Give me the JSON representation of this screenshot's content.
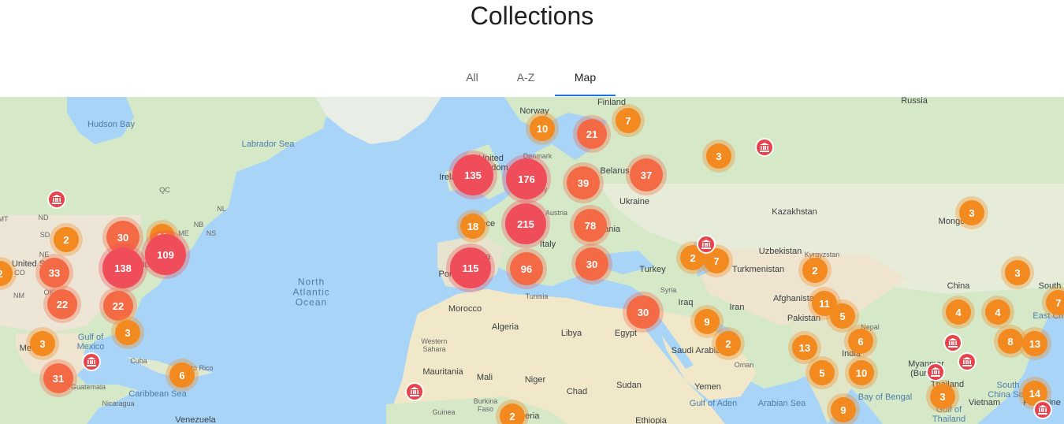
{
  "page": {
    "title": "Collections"
  },
  "tabs": [
    {
      "label": "All",
      "active": false
    },
    {
      "label": "A-Z",
      "active": false
    },
    {
      "label": "Map",
      "active": true
    }
  ],
  "colors": {
    "accent": "#1a73e8",
    "cluster_small": "#f38a1f",
    "cluster_medium": "#f36a44",
    "cluster_large": "#ef4d5a",
    "museum": "#e8434d",
    "water": "#a8d4f7"
  },
  "map": {
    "labels": [
      {
        "text": "Hudson Bay",
        "type": "water"
      },
      {
        "text": "Labrador Sea",
        "type": "water"
      },
      {
        "text": "North\nAtlantic\nOcean",
        "type": "ocean"
      },
      {
        "text": "Gulf of\nMexico",
        "type": "water"
      },
      {
        "text": "Caribbean Sea",
        "type": "water"
      },
      {
        "text": "Finland",
        "type": "land"
      },
      {
        "text": "Norway",
        "type": "land"
      },
      {
        "text": "Russia",
        "type": "land"
      },
      {
        "text": "Denmark",
        "type": "small"
      },
      {
        "text": "United\nKingdom",
        "type": "land"
      },
      {
        "text": "Ireland",
        "type": "land"
      },
      {
        "text": "Germany",
        "type": "small"
      },
      {
        "text": "Belarus",
        "type": "land"
      },
      {
        "text": "Ukraine",
        "type": "land"
      },
      {
        "text": "Kazakhstan",
        "type": "land"
      },
      {
        "text": "Mongolia",
        "type": "land"
      },
      {
        "text": "Austria",
        "type": "small"
      },
      {
        "text": "France",
        "type": "land"
      },
      {
        "text": "Romania",
        "type": "land"
      },
      {
        "text": "Italy",
        "type": "land"
      },
      {
        "text": "Spain",
        "type": "land"
      },
      {
        "text": "Portugal",
        "type": "land"
      },
      {
        "text": "Greece",
        "type": "small"
      },
      {
        "text": "Turkey",
        "type": "land"
      },
      {
        "text": "Uzbekistan",
        "type": "land"
      },
      {
        "text": "Kyrgyzstan",
        "type": "small"
      },
      {
        "text": "Turkmenistan",
        "type": "land"
      },
      {
        "text": "China",
        "type": "land"
      },
      {
        "text": "South",
        "type": "land"
      },
      {
        "text": "Tunisia",
        "type": "small"
      },
      {
        "text": "Syria",
        "type": "small"
      },
      {
        "text": "Iraq",
        "type": "land"
      },
      {
        "text": "Iran",
        "type": "land"
      },
      {
        "text": "Afghanistan",
        "type": "land"
      },
      {
        "text": "Pakistan",
        "type": "land"
      },
      {
        "text": "Nepal",
        "type": "small"
      },
      {
        "text": "India",
        "type": "land"
      },
      {
        "text": "Morocco",
        "type": "land"
      },
      {
        "text": "Algeria",
        "type": "land"
      },
      {
        "text": "Libya",
        "type": "land"
      },
      {
        "text": "Egypt",
        "type": "land"
      },
      {
        "text": "Saudi Arabia",
        "type": "land"
      },
      {
        "text": "Oman",
        "type": "small"
      },
      {
        "text": "Western\nSahara",
        "type": "small"
      },
      {
        "text": "Mauritania",
        "type": "land"
      },
      {
        "text": "Mali",
        "type": "land"
      },
      {
        "text": "Niger",
        "type": "land"
      },
      {
        "text": "Chad",
        "type": "land"
      },
      {
        "text": "Sudan",
        "type": "land"
      },
      {
        "text": "Yemen",
        "type": "land"
      },
      {
        "text": "Gulf of Aden",
        "type": "water"
      },
      {
        "text": "Arabian Sea",
        "type": "water"
      },
      {
        "text": "Bay of Bengal",
        "type": "water"
      },
      {
        "text": "Myanmar\n(Burma)",
        "type": "land"
      },
      {
        "text": "Thailand",
        "type": "land"
      },
      {
        "text": "Vietnam",
        "type": "land"
      },
      {
        "text": "South\nChina Sea",
        "type": "water"
      },
      {
        "text": "Gulf of\nThailand",
        "type": "water"
      },
      {
        "text": "Philippine",
        "type": "land"
      },
      {
        "text": "East Ch",
        "type": "water"
      },
      {
        "text": "Ethiopia",
        "type": "land"
      },
      {
        "text": "Burkina\nFaso",
        "type": "small"
      },
      {
        "text": "Guinea",
        "type": "small"
      },
      {
        "text": "Nigeria",
        "type": "land"
      },
      {
        "text": "Venezuela",
        "type": "land"
      },
      {
        "text": "Nicaragua",
        "type": "small"
      },
      {
        "text": "Guatemala",
        "type": "small"
      },
      {
        "text": "Cuba",
        "type": "small"
      },
      {
        "text": "Puerto Rico",
        "type": "small"
      },
      {
        "text": "Mexico",
        "type": "land"
      },
      {
        "text": "United States",
        "type": "land"
      },
      {
        "text": "QC",
        "type": "small"
      },
      {
        "text": "NL",
        "type": "small"
      },
      {
        "text": "NB",
        "type": "small"
      },
      {
        "text": "NS",
        "type": "small"
      },
      {
        "text": "ME",
        "type": "small"
      },
      {
        "text": "MT",
        "type": "small"
      },
      {
        "text": "ND",
        "type": "small"
      },
      {
        "text": "SD",
        "type": "small"
      },
      {
        "text": "NE",
        "type": "small"
      },
      {
        "text": "CO",
        "type": "small"
      },
      {
        "text": "NM",
        "type": "small"
      },
      {
        "text": "OK",
        "type": "small"
      },
      {
        "text": "MD",
        "type": "small"
      }
    ],
    "clusters": [
      "10",
      "21",
      "7",
      "3",
      "135",
      "176",
      "39",
      "37",
      "3",
      "2",
      "30",
      "11",
      "109",
      "138",
      "33",
      "22",
      "22",
      "3",
      "3",
      "31",
      "6",
      "18",
      "215",
      "78",
      "115",
      "96",
      "30",
      "2",
      "7",
      "2",
      "3",
      "11",
      "5",
      "30",
      "9",
      "2",
      "6",
      "13",
      "5",
      "10",
      "4",
      "4",
      "8",
      "13",
      "3",
      "9",
      "14",
      "2",
      "7",
      "2"
    ]
  }
}
